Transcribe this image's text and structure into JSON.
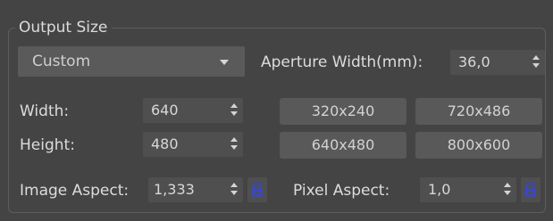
{
  "group": {
    "title": "Output Size"
  },
  "preset_dropdown": {
    "value": "Custom"
  },
  "aperture": {
    "label": "Aperture Width(mm):",
    "value": "36,0"
  },
  "width": {
    "label": "Width:",
    "value": "640"
  },
  "height": {
    "label": "Height:",
    "value": "480"
  },
  "presets": [
    "320x240",
    "720x486",
    "640x480",
    "800x600"
  ],
  "image_aspect": {
    "label": "Image Aspect:",
    "value": "1,333"
  },
  "pixel_aspect": {
    "label": "Pixel Aspect:",
    "value": "1,0"
  },
  "icons": {
    "lock": "lock-icon"
  },
  "colors": {
    "background": "#444444",
    "control": "#4f4f4f",
    "button": "#595959",
    "accent_lock": "#3a46c9"
  }
}
